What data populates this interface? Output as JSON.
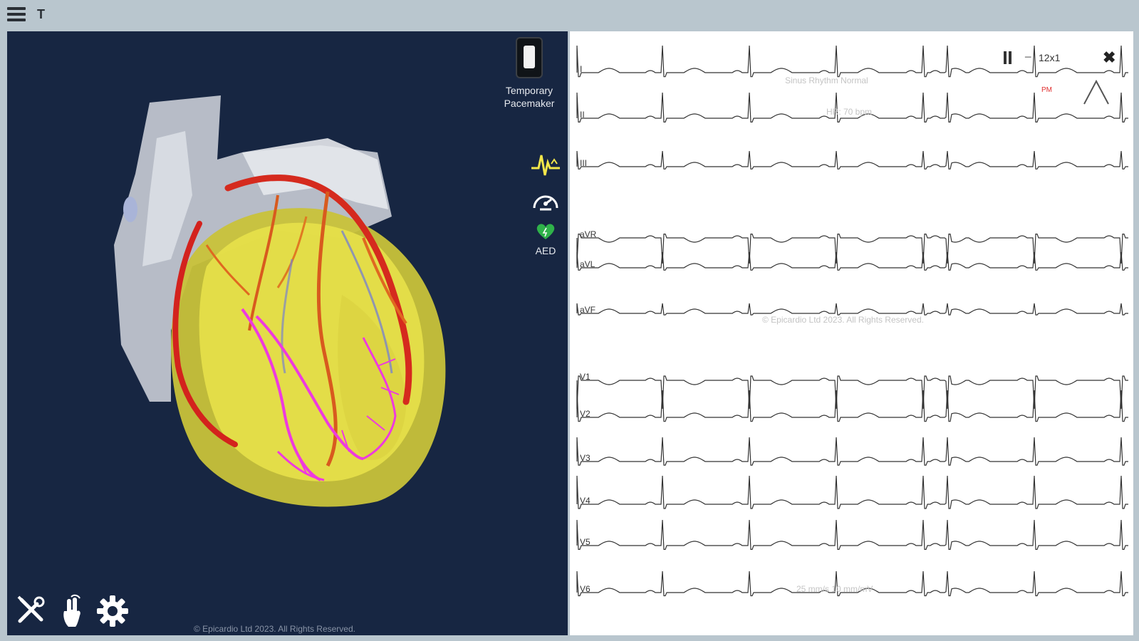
{
  "app": {
    "title_letter": "T"
  },
  "left": {
    "pacemaker_label": "Temporary Pacemaker",
    "aed_label": "AED",
    "copyright": "© Epicardio Ltd 2023. All Rights Reserved."
  },
  "ecg": {
    "lead_view": "12x1",
    "pace_marker": "PM",
    "watermark_top": "Sinus Rhythm Normal",
    "heart_rate": "HR: 70 bpm",
    "watermark_mid": "© Epicardio Ltd 2023. All Rights Reserved.",
    "paper_speed": "25 mm/s   10 mm/mV",
    "leads": [
      "I",
      "II",
      "III",
      "aVR",
      "aVL",
      "aVF",
      "V1",
      "V2",
      "V3",
      "V4",
      "V5",
      "V6"
    ]
  },
  "colors": {
    "left_bg": "#172642",
    "ecg_bg": "#ffffff",
    "trace": "#333333",
    "accent_yellow": "#f2e64a",
    "aed_green": "#2fb24a"
  },
  "icons": {
    "menu": "menu-icon",
    "pacemaker": "pacemaker-icon",
    "ecg_monitor": "ecg-monitor-icon",
    "gauge": "gauge-icon",
    "aed": "aed-heart-icon",
    "tools": "tools-icon",
    "hand": "hand-icon",
    "settings": "gear-icon"
  }
}
